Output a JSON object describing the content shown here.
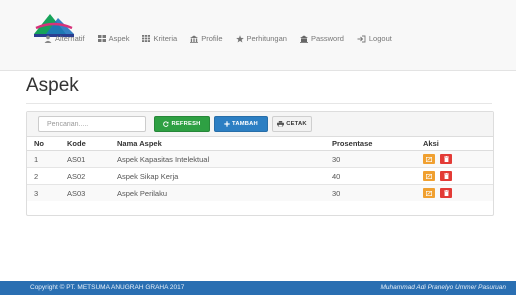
{
  "nav": {
    "items": [
      {
        "label": "Alternatif",
        "icon": "user-icon"
      },
      {
        "label": "Aspek",
        "icon": "grid-icon"
      },
      {
        "label": "Kriteria",
        "icon": "table-icon"
      },
      {
        "label": "Profile",
        "icon": "building-icon"
      },
      {
        "label": "Perhitungan",
        "icon": "star-icon"
      },
      {
        "label": "Password",
        "icon": "bank-icon"
      },
      {
        "label": "Logout",
        "icon": "logout-icon"
      }
    ]
  },
  "page": {
    "title": "Aspek"
  },
  "toolbar": {
    "search_placeholder": "Pencarian.....",
    "refresh_label": "REFRESH",
    "tambah_label": "TAMBAH",
    "cetak_label": "CETAK"
  },
  "table": {
    "headers": [
      "No",
      "Kode",
      "Nama Aspek",
      "Prosentase",
      "Aksi"
    ],
    "rows": [
      {
        "no": "1",
        "kode": "AS01",
        "nama": "Aspek Kapasitas Intelektual",
        "prosentase": "30"
      },
      {
        "no": "2",
        "kode": "AS02",
        "nama": "Aspek Sikap Kerja",
        "prosentase": "40"
      },
      {
        "no": "3",
        "kode": "AS03",
        "nama": "Aspek Perilaku",
        "prosentase": "30"
      }
    ]
  },
  "footer": {
    "copyright": "Copyright © PT. METSUMA ANUGRAH GRAHA 2017",
    "author": "Muhammad Adi Pranelyo Ummer Pasuruan"
  },
  "colors": {
    "refresh": "#2ea043",
    "tambah": "#2c7fc3",
    "edit": "#f0a030",
    "delete": "#e33b36",
    "footer": "#2a6fb2"
  }
}
